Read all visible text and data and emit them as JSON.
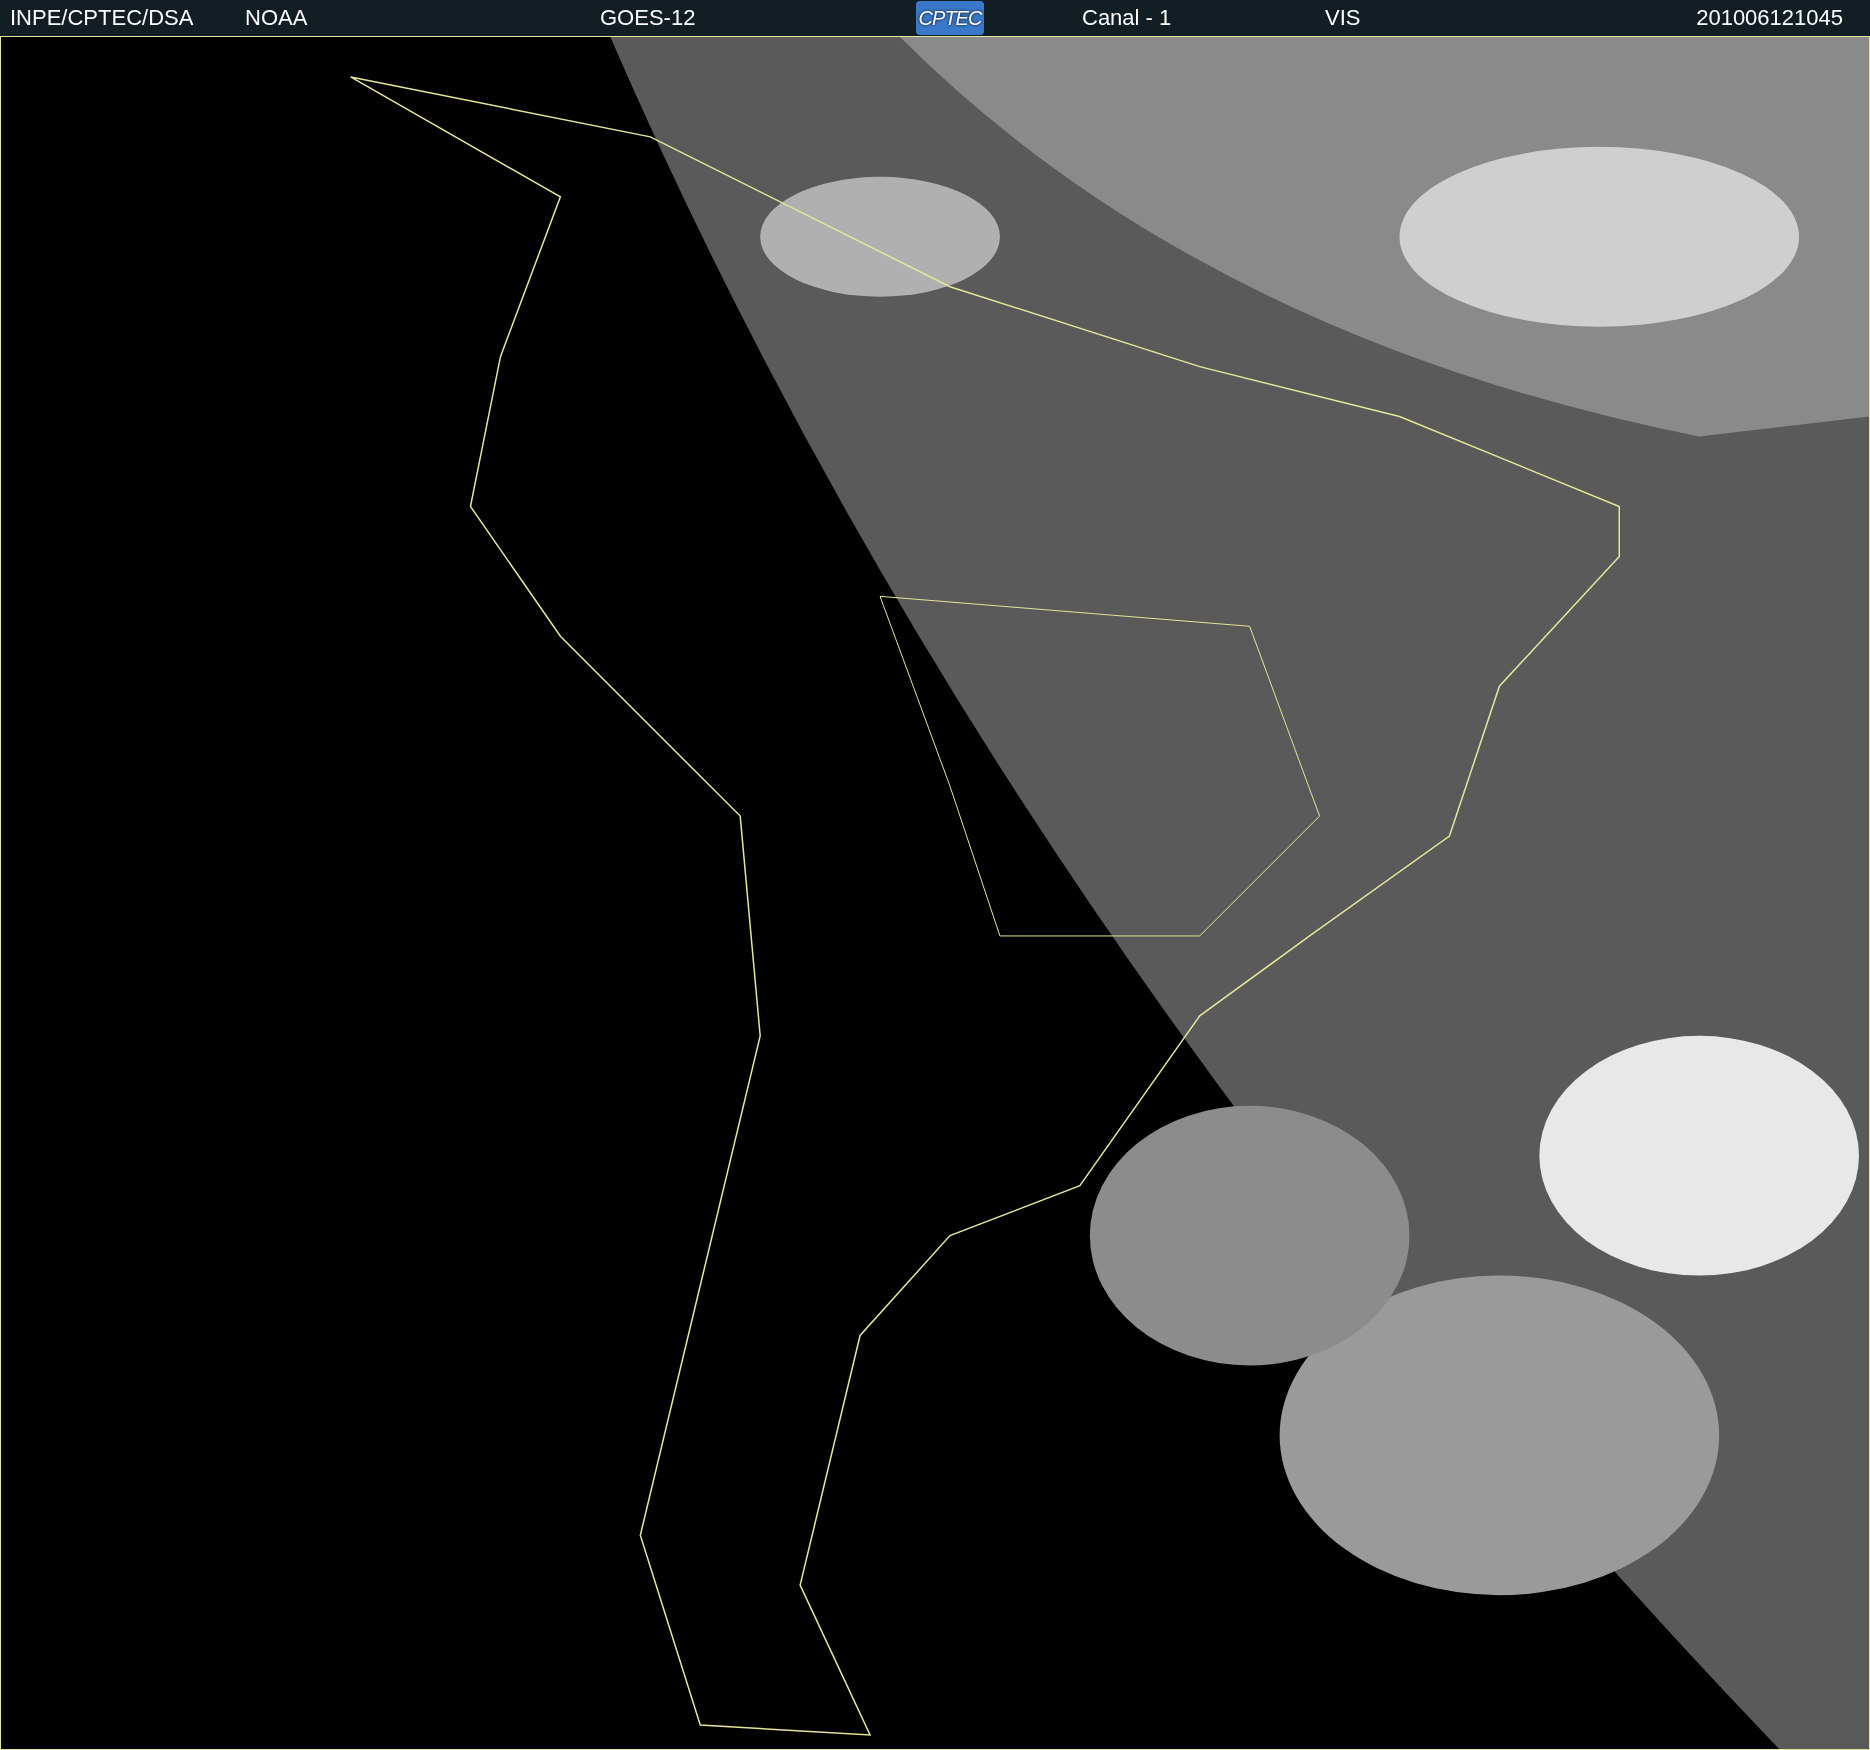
{
  "header": {
    "source": "INPE/CPTEC/DSA",
    "agency": "NOAA",
    "satellite": "GOES-12",
    "logo": "CPTEC",
    "channel": "Canal - 1",
    "band": "VIS",
    "timestamp": "201006121045"
  }
}
